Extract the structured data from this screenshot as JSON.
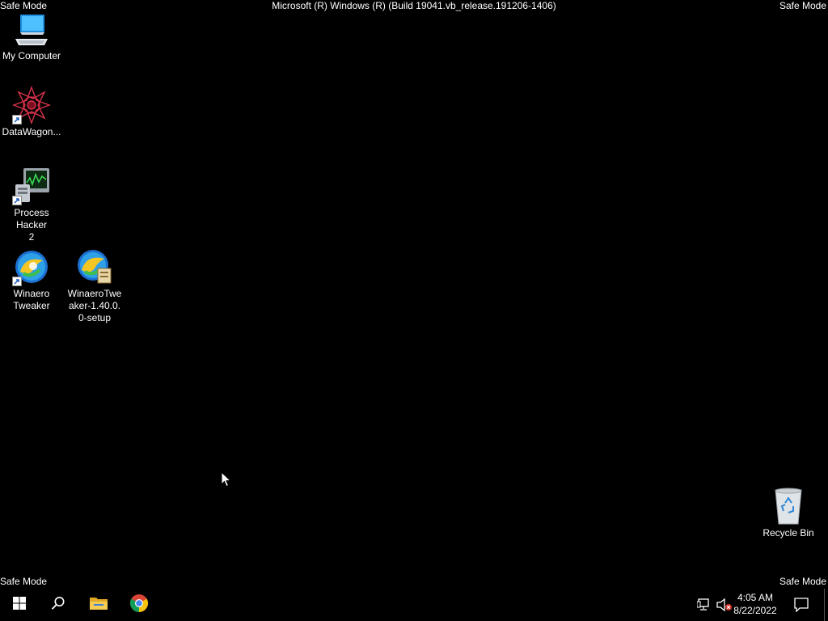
{
  "watermark": {
    "safe_mode": "Safe Mode",
    "build": "Microsoft (R) Windows (R) (Build 19041.vb_release.191206-1406)"
  },
  "desktop": {
    "icons": [
      {
        "label": "My Computer",
        "icon": "computer-icon"
      },
      {
        "label": "DataWagon...",
        "icon": "datawagon-icon"
      },
      {
        "label": "Process Hacker 2",
        "icon": "process-hacker-icon"
      },
      {
        "label": "Winaero Tweaker",
        "icon": "winaero-tweaker-icon"
      },
      {
        "label": "WinaeroTweaker-1.40.0.0-setup",
        "icon": "winaero-setup-icon"
      },
      {
        "label": "Recycle Bin",
        "icon": "recycle-bin-icon"
      }
    ]
  },
  "taskbar": {
    "buttons": [
      {
        "name": "start",
        "icon": "windows-logo-icon"
      },
      {
        "name": "search",
        "icon": "search-icon"
      },
      {
        "name": "file-explorer",
        "icon": "folder-icon"
      },
      {
        "name": "chrome",
        "icon": "chrome-icon"
      }
    ],
    "tray": {
      "time": "4:05 AM",
      "date": "8/22/2022",
      "icons": [
        "network-icon",
        "volume-muted-icon",
        "notification-icon"
      ]
    }
  },
  "colors": {
    "background": "#000000",
    "text": "#ffffff",
    "folder": "#f0c24b",
    "muted_badge": "#d9302c"
  }
}
